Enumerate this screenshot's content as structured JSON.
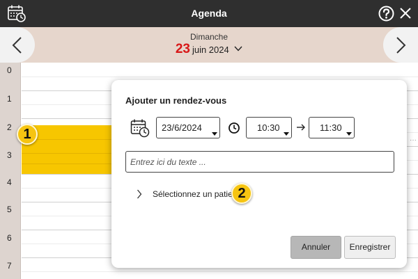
{
  "window": {
    "title": "Agenda",
    "icons": {
      "calendar": "calendar-clock-icon",
      "help": "help-circle-icon",
      "close": "close-icon"
    }
  },
  "date_nav": {
    "day_name": "Dimanche",
    "day_number": "23",
    "month_year": "juin 2024",
    "icons": {
      "prev": "chevron-left-icon",
      "next": "chevron-right-icon",
      "dropdown": "chevron-down-icon"
    }
  },
  "agenda": {
    "hours": [
      "0",
      "1",
      "2",
      "3",
      "4",
      "5",
      "6",
      "7"
    ]
  },
  "callouts": {
    "first": "1",
    "second": "2"
  },
  "dialog": {
    "title": "Ajouter un rendez-vous",
    "date_value": "23/6/2024",
    "start_time": "10:30",
    "end_time": "11:30",
    "text_placeholder": "Entrez ici du texte ...",
    "patient_label": "Sélectionnez un patient",
    "cancel_label": "Annuler",
    "save_label": "Enregistrer"
  },
  "colors": {
    "titlebar": "#2f2f2f",
    "datebar": "#e6d6cc",
    "day_number": "#d81818",
    "appointment": "#f7c600",
    "badge": "#f6c411"
  }
}
